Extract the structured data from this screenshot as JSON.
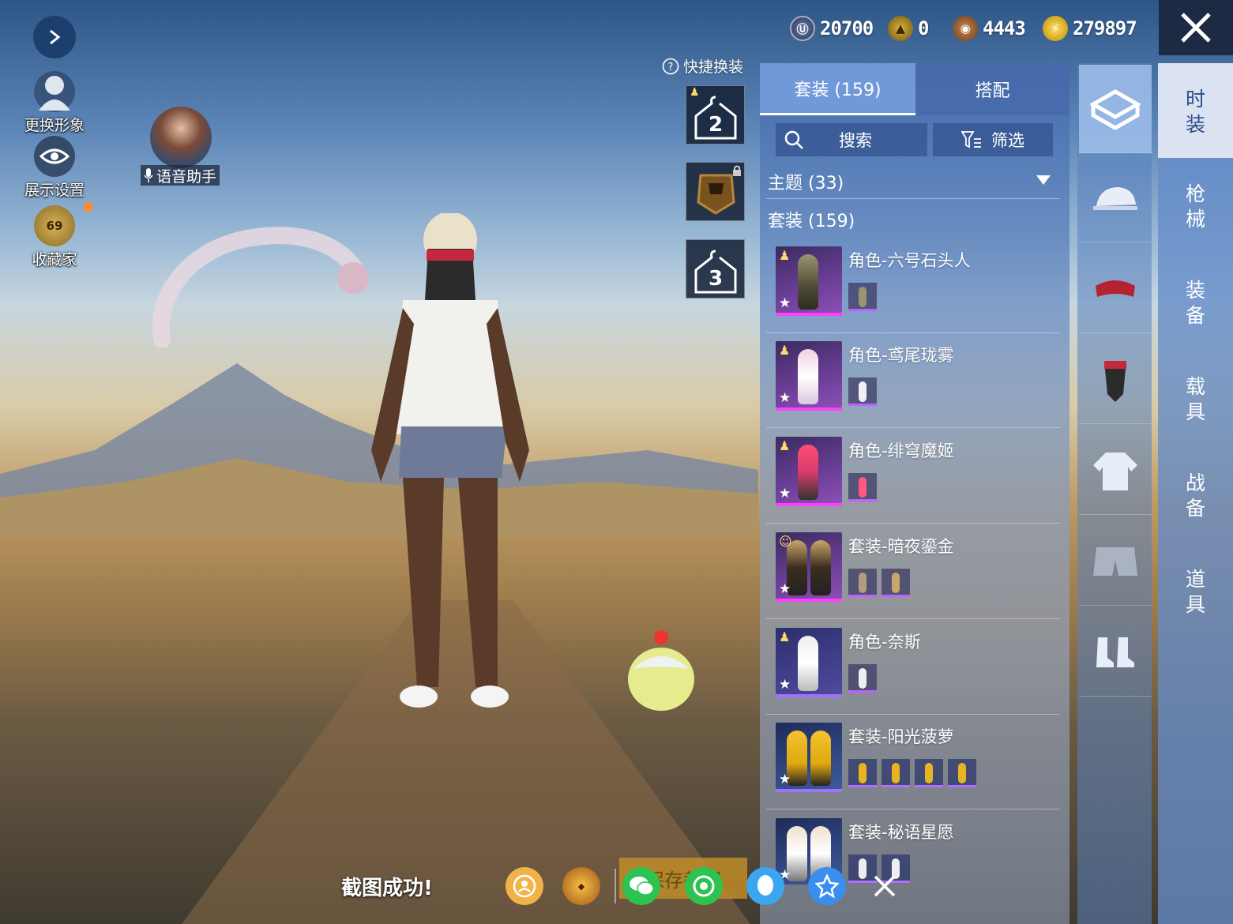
{
  "currencies": [
    {
      "icon": "uc-coin-icon",
      "value": "20700"
    },
    {
      "icon": "ag-coin-icon",
      "value": "0"
    },
    {
      "icon": "bronze-coin-icon",
      "value": "4443"
    },
    {
      "icon": "lightning-coin-icon",
      "value": "279897"
    }
  ],
  "left_menu": {
    "change_avatar": "更换形象",
    "display_settings": "展示设置",
    "collector": "收藏家",
    "collector_level": "69"
  },
  "voice_assistant": "语音助手",
  "quick_change": "快捷换装",
  "outfit_slots": [
    "2",
    "3"
  ],
  "panel": {
    "tabs": [
      "套装 (159)",
      "搭配"
    ],
    "search": "搜索",
    "filter": "筛选",
    "theme_header": "主题 (33)",
    "suit_header": "套装 (159)"
  },
  "items": [
    {
      "name": "角色-六号石头人"
    },
    {
      "name": "角色-鸢尾珑雾"
    },
    {
      "name": "角色-绯穹魔姬"
    },
    {
      "name": "套装-暗夜鎏金"
    },
    {
      "name": "角色-奈斯"
    },
    {
      "name": "套装-阳光菠萝"
    },
    {
      "name": "套装-秘语星愿"
    }
  ],
  "side_tabs": [
    "时\n装",
    "枪\n械",
    "装\n备",
    "载\n具",
    "战\n备",
    "道\n具"
  ],
  "screenshot_toast": "截图成功!",
  "save_button": "保存截图",
  "accent_color": "#ff40ff"
}
